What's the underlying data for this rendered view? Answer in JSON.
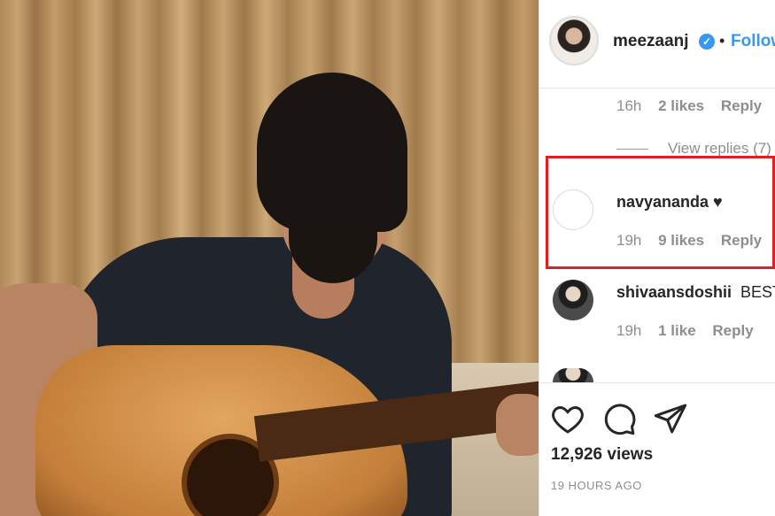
{
  "post": {
    "username": "meezaanj",
    "verified_mark": "✓",
    "separator": "•",
    "follow_label": "Follow"
  },
  "comments": [
    {
      "time": "16h",
      "likes": "2 likes",
      "reply": "Reply",
      "view_replies": "View replies (7)"
    },
    {
      "user": "navyananda ♥",
      "time": "19h",
      "likes": "9 likes",
      "reply": "Reply"
    },
    {
      "user": "shivaansdoshii",
      "text": "BEST",
      "time": "19h",
      "likes": "1 like",
      "reply": "Reply"
    }
  ],
  "actions": {
    "like_icon": "heart-icon",
    "comment_icon": "comment-icon",
    "share_icon": "share-icon",
    "views": "12,926 views",
    "posted": "19 HOURS AGO"
  },
  "colors": {
    "accent": "#3897f0",
    "highlight": "#e02020",
    "muted_text": "#8e8e8e"
  }
}
